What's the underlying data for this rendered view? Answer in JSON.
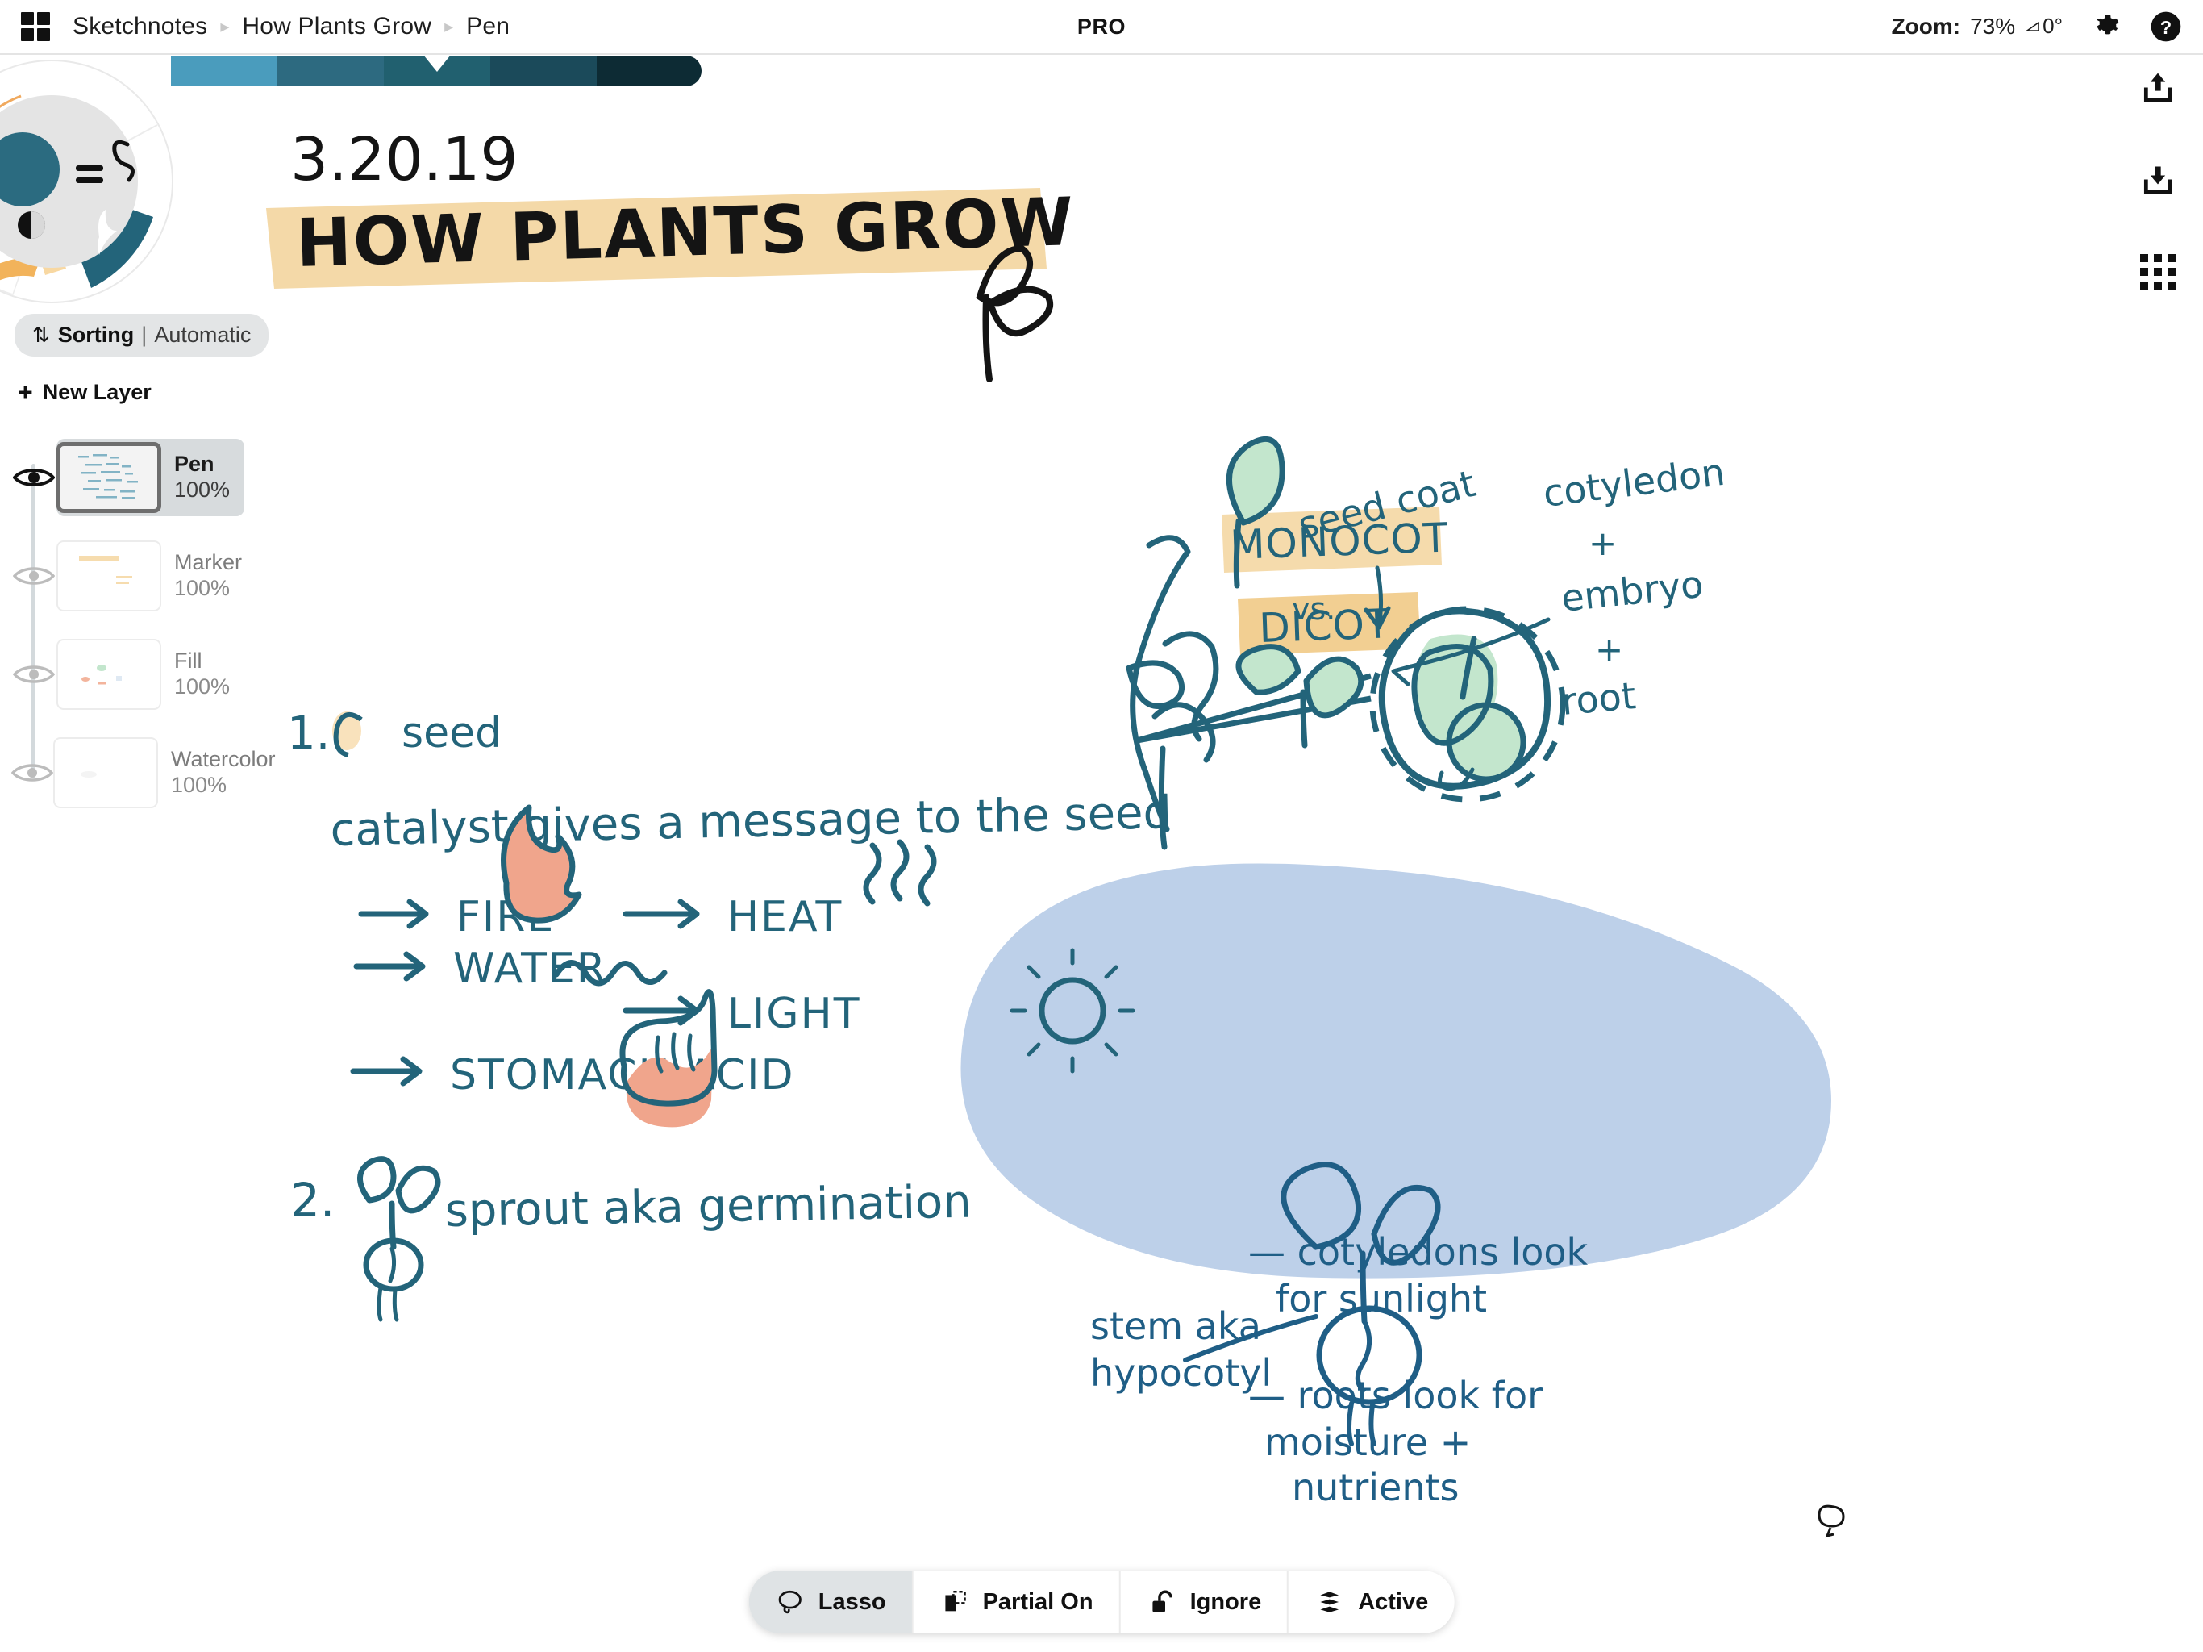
{
  "header": {
    "app_icon": "grid-apps-icon",
    "breadcrumbs": [
      {
        "label": "Sketchnotes"
      },
      {
        "label": "How Plants Grow"
      },
      {
        "label": "Pen"
      }
    ],
    "separator": "▸",
    "pro_badge": "PRO",
    "zoom_label": "Zoom:",
    "zoom_value": "73%",
    "angle_value": "0°",
    "settings_icon": "gear-icon",
    "help_icon": "help-icon"
  },
  "palette": {
    "selected_index": 2,
    "swatches": [
      "#4a9cbd",
      "#2d6a80",
      "#21606f",
      "#1b4a5a",
      "#0d2b34"
    ]
  },
  "tool_wheel": {
    "current_color": "#2b6b80",
    "icons": [
      "equals-icon",
      "contrast-icon",
      "waveform-icon",
      "squiggle-icon",
      "pen-stroke-icon"
    ],
    "segment_colors": {
      "selected_pen": "#23647a",
      "marker_salmon": "#f0a58c",
      "marker_orange": "#f0b252",
      "marker_tan": "#f7d9a0"
    }
  },
  "layers_panel": {
    "panel_icon": "layers-icon",
    "sorting": {
      "icon": "sort-arrows-icon",
      "label": "Sorting",
      "separator": "|",
      "value": "Automatic"
    },
    "new_layer": {
      "icon": "plus-icon",
      "label": "New Layer"
    },
    "layers": [
      {
        "name": "Pen",
        "opacity": "100%",
        "selected": true,
        "visible": true,
        "thumb": "pen-sketch-thumb"
      },
      {
        "name": "Marker",
        "opacity": "100%",
        "selected": false,
        "visible": true,
        "thumb": "marker-thumb"
      },
      {
        "name": "Fill",
        "opacity": "100%",
        "selected": false,
        "visible": true,
        "thumb": "fill-thumb"
      },
      {
        "name": "Watercolor",
        "opacity": "100%",
        "selected": false,
        "visible": true,
        "thumb": "watercolor-thumb"
      }
    ]
  },
  "right_rail": [
    {
      "icon": "share-upload-icon"
    },
    {
      "icon": "download-icon"
    },
    {
      "icon": "apps-grid-icon"
    }
  ],
  "bottom_toolbar": {
    "items": [
      {
        "label": "Lasso",
        "icon": "lasso-icon",
        "active": true
      },
      {
        "label": "Partial On",
        "icon": "partial-selection-icon",
        "active": false
      },
      {
        "label": "Ignore",
        "icon": "unlock-icon",
        "active": false
      },
      {
        "label": "Active",
        "icon": "layers-stack-icon",
        "active": false
      }
    ]
  },
  "canvas": {
    "ink_color": "#23647a",
    "highlighter_color": "#f4d9a8",
    "green_fill": "#c3e6cd",
    "salmon_fill": "#f0a58c",
    "blue_blob_color": "#bdd0e9",
    "date": "3.20.19",
    "title": "HOW PLANTS GROW",
    "notes": [
      {
        "id": "seed-coat-label",
        "text": "seed coat"
      },
      {
        "id": "cotyledon-label",
        "text": "cotyledon"
      },
      {
        "id": "plus-1",
        "text": "+"
      },
      {
        "id": "embryo-label",
        "text": "embryo"
      },
      {
        "id": "plus-2",
        "text": "+"
      },
      {
        "id": "root-label",
        "text": "root"
      },
      {
        "id": "item-1-number",
        "text": "1."
      },
      {
        "id": "item-1-text",
        "text": "seed"
      },
      {
        "id": "catalyst-line",
        "text": "catalyst gives a message to the seed"
      },
      {
        "id": "arrow-fire",
        "text": "FIRE"
      },
      {
        "id": "arrow-water",
        "text": "WATER"
      },
      {
        "id": "arrow-stomach-acid",
        "text": "STOMACH ACID"
      },
      {
        "id": "arrow-heat",
        "text": "HEAT"
      },
      {
        "id": "arrow-light",
        "text": "LIGHT"
      },
      {
        "id": "monocot-label",
        "text": "MONOCOT"
      },
      {
        "id": "vs-label",
        "text": "vs."
      },
      {
        "id": "dicot-label",
        "text": "DICOT"
      },
      {
        "id": "item-2-number",
        "text": "2."
      },
      {
        "id": "item-2-text",
        "text": "sprout aka germination"
      },
      {
        "id": "stem-label-1",
        "text": "stem aka"
      },
      {
        "id": "stem-label-2",
        "text": "hypocotyl"
      },
      {
        "id": "cotyledons-note-1",
        "text": "— cotyledons look"
      },
      {
        "id": "cotyledons-note-2",
        "text": "for sunlight"
      },
      {
        "id": "roots-note-1",
        "text": "— roots look for"
      },
      {
        "id": "roots-note-2",
        "text": "moisture +"
      },
      {
        "id": "roots-note-3",
        "text": "nutrients"
      }
    ]
  }
}
